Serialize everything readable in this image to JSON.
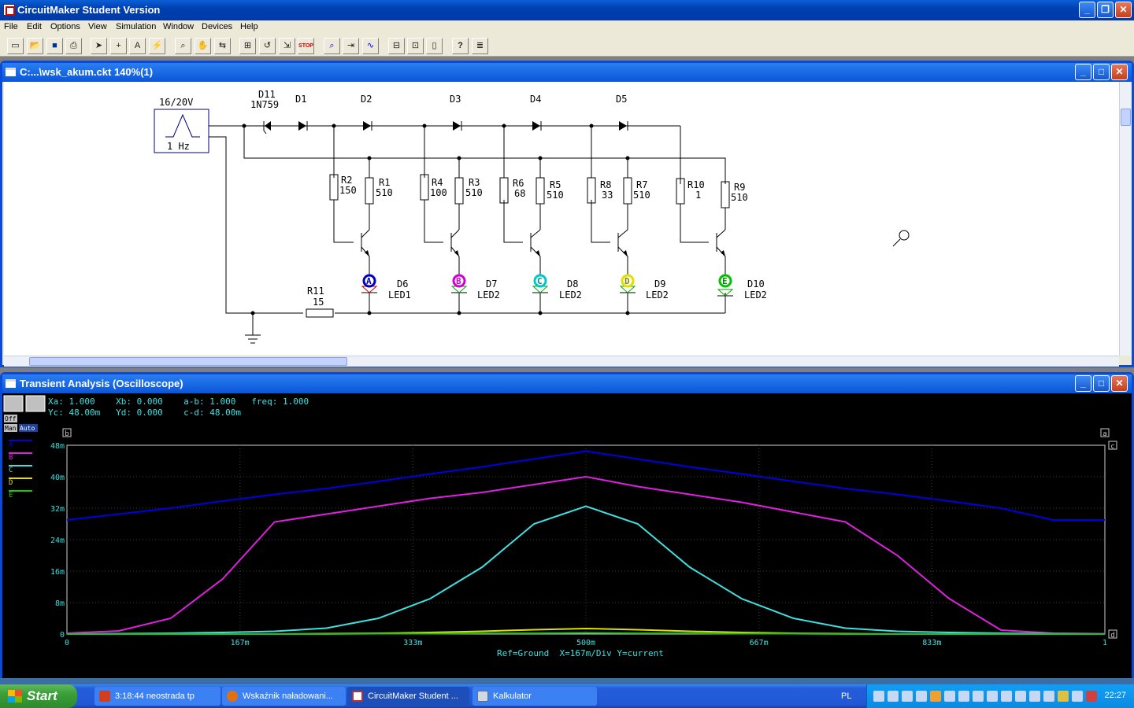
{
  "app": {
    "title": "CircuitMaker Student Version",
    "minimize": "_",
    "restore": "❐",
    "close": "✕"
  },
  "menu": [
    "File",
    "Edit",
    "Options",
    "View",
    "Simulation",
    "Window",
    "Devices",
    "Help"
  ],
  "toolbar": {
    "buttons": [
      "new-icon",
      "open-icon",
      "save-icon",
      "print-icon",
      "pointer-icon",
      "wire-icon",
      "text-icon",
      "probe-icon",
      "zoom-icon",
      "pan-icon",
      "flip-icon",
      "rotate-icon",
      "undo-icon",
      "step-icon",
      "stop-icon",
      "trace-icon",
      "digital-icon",
      "analog-icon",
      "grid-icon",
      "part-icon",
      "library-icon",
      "help-icon",
      "settings-icon"
    ],
    "stop_label": "STOP"
  },
  "schematic": {
    "title": "C:...\\wsk_akum.ckt 140%(1)",
    "source": {
      "label": "16/20V",
      "freq": "1 Hz"
    },
    "diodes": [
      {
        "name": "D11",
        "sub": "1N759"
      },
      {
        "name": "D1",
        "sub": ""
      },
      {
        "name": "D2",
        "sub": ""
      },
      {
        "name": "D3",
        "sub": ""
      },
      {
        "name": "D4",
        "sub": ""
      },
      {
        "name": "D5",
        "sub": ""
      }
    ],
    "resistors": [
      {
        "name": "R2",
        "value": "150"
      },
      {
        "name": "R1",
        "value": "510"
      },
      {
        "name": "R4",
        "value": "100"
      },
      {
        "name": "R3",
        "value": "510"
      },
      {
        "name": "R6",
        "value": "68"
      },
      {
        "name": "R5",
        "value": "510"
      },
      {
        "name": "R8",
        "value": "33"
      },
      {
        "name": "R7",
        "value": "510"
      },
      {
        "name": "R10",
        "value": "1"
      },
      {
        "name": "R9",
        "value": "510"
      },
      {
        "name": "R11",
        "value": "15"
      }
    ],
    "leds": [
      {
        "probe": "A",
        "name": "D6",
        "part": "LED1",
        "color": "#0000c0"
      },
      {
        "probe": "B",
        "name": "D7",
        "part": "LED2",
        "color": "#d000d0"
      },
      {
        "probe": "C",
        "name": "D8",
        "part": "LED2",
        "color": "#00c8c8"
      },
      {
        "probe": "D",
        "name": "D9",
        "part": "LED2",
        "color": "#e0e000"
      },
      {
        "probe": "E",
        "name": "D10",
        "part": "LED2",
        "color": "#00c000"
      }
    ]
  },
  "scope": {
    "title": "Transient Analysis (Oscilloscope)",
    "readout_line1": "Xa: 1.000    Xb: 0.000    a-b: 1.000   freq: 1.000",
    "readout_line2": "Yc: 48.00m   Yd: 0.000    c-d: 48.00m",
    "ctrl": {
      "off": "Off",
      "man": "Man",
      "auto": "Auto"
    },
    "cursor_labels": {
      "b": "b",
      "a": "a",
      "c": "c",
      "d": "d"
    },
    "footer": "Ref=Ground  X=167m/Div Y=current"
  },
  "chart_data": {
    "type": "line",
    "xlabel": "",
    "ylabel": "",
    "xlim": [
      0,
      1
    ],
    "ylim": [
      0,
      48
    ],
    "x_ticks": [
      "0",
      "167m",
      "333m",
      "500m",
      "667m",
      "833m",
      "1"
    ],
    "y_ticks": [
      "0",
      "8m",
      "16m",
      "24m",
      "32m",
      "40m",
      "48m"
    ],
    "grid": true,
    "legend_position": "left",
    "x": [
      0,
      0.05,
      0.1,
      0.15,
      0.2,
      0.25,
      0.3,
      0.35,
      0.4,
      0.45,
      0.5,
      0.55,
      0.6,
      0.65,
      0.7,
      0.75,
      0.8,
      0.85,
      0.9,
      0.95,
      1.0
    ],
    "series": [
      {
        "name": "A",
        "color": "#0000e0",
        "values": [
          29,
          30.5,
          32,
          33.8,
          35.5,
          37,
          38.8,
          40.7,
          42.5,
          44.5,
          46.5,
          44.5,
          42.5,
          40.7,
          38.8,
          37,
          35.5,
          33.8,
          32,
          29,
          29
        ]
      },
      {
        "name": "B",
        "color": "#e020e0",
        "values": [
          0.2,
          0.8,
          4,
          14,
          28.5,
          30.5,
          32.5,
          34.5,
          36,
          38,
          40,
          37.5,
          35.5,
          33.5,
          31,
          28.5,
          20,
          9,
          1,
          0.2,
          0.1
        ]
      },
      {
        "name": "C",
        "color": "#40e0e0",
        "values": [
          0,
          0.1,
          0.2,
          0.4,
          0.7,
          1.5,
          4,
          9,
          17,
          28,
          32.5,
          28,
          17,
          9,
          4,
          1.5,
          0.7,
          0.4,
          0.2,
          0.1,
          0
        ]
      },
      {
        "name": "D",
        "color": "#e0e000",
        "values": [
          0,
          0,
          0,
          0,
          0,
          0.1,
          0.2,
          0.4,
          0.7,
          1.1,
          1.4,
          1.1,
          0.7,
          0.4,
          0.2,
          0.1,
          0,
          0,
          0,
          0,
          0
        ]
      },
      {
        "name": "E",
        "color": "#20c020",
        "values": [
          0,
          0,
          0,
          0,
          0,
          0,
          0.1,
          0.1,
          0.2,
          0.2,
          0.3,
          0.2,
          0.2,
          0.1,
          0.1,
          0,
          0,
          0,
          0,
          0,
          0
        ]
      }
    ]
  },
  "taskbar": {
    "start": "Start",
    "items": [
      {
        "label": "3:18:44 neostrada tp",
        "color": "#d04020"
      },
      {
        "label": "Wskaźnik naładowani...",
        "color": "#e07010"
      },
      {
        "label": "CircuitMaker Student ...",
        "color": "#c03030"
      },
      {
        "label": "Kalkulator",
        "color": "#607080"
      }
    ],
    "lang": "PL",
    "clock": "22:27"
  }
}
